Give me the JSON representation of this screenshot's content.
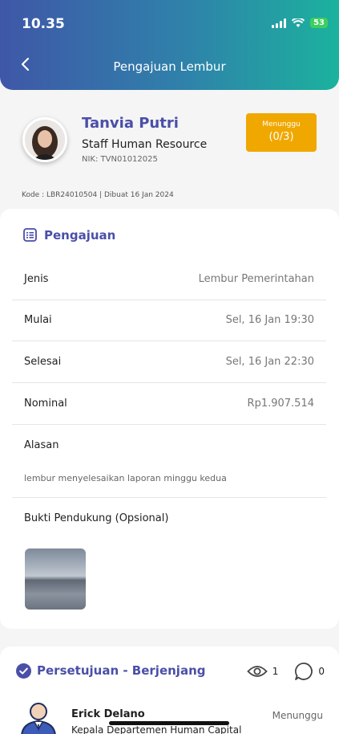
{
  "status_bar": {
    "time": "10.35",
    "battery": "53"
  },
  "header": {
    "title": "Pengajuan Lembur"
  },
  "profile": {
    "name": "Tanvia Putri",
    "role": "Staff Human Resource",
    "nik": "NIK: TVN01012025",
    "status_label": "Menunggu",
    "status_count": "(0/3)"
  },
  "kode": "Kode : LBR24010504 | Dibuat 16 Jan 2024",
  "pengajuan": {
    "title": "Pengajuan",
    "rows": [
      {
        "label": "Jenis",
        "value": "Lembur Pemerintahan"
      },
      {
        "label": "Mulai",
        "value": "Sel, 16 Jan 19:30"
      },
      {
        "label": "Selesai",
        "value": "Sel, 16 Jan 22:30"
      },
      {
        "label": "Nominal",
        "value": "Rp1.907.514"
      }
    ],
    "alasan_label": "Alasan",
    "alasan_value": "lembur menyelesaikan laporan minggu kedua",
    "bukti_label": "Bukti Pendukung (Opsional)"
  },
  "persetujuan": {
    "title": "Persetujuan - Berjenjang",
    "views": "1",
    "comments": "0",
    "approver": {
      "name": "Erick Delano",
      "role": "Kepala Departemen Human Capital",
      "status": "Menunggu"
    }
  },
  "colors": {
    "accent": "#4a4fa8",
    "badge": "#f0a800",
    "gradient_start": "#3f57a8",
    "gradient_end": "#1bb29e"
  }
}
